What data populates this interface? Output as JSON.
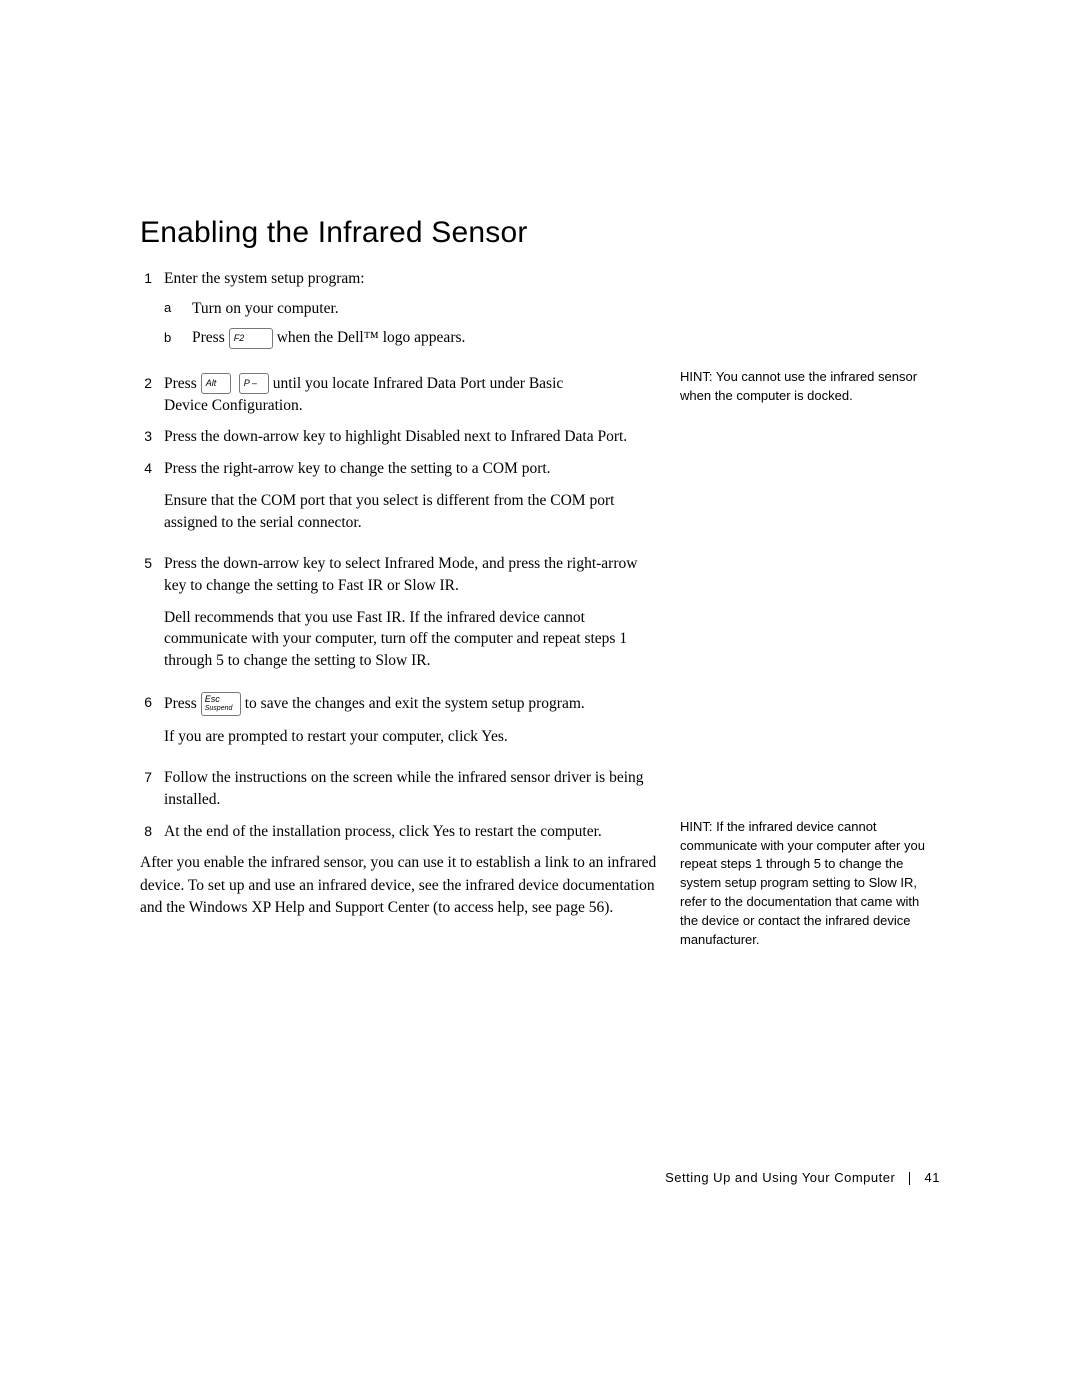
{
  "heading": "Enabling the Infrared Sensor",
  "steps": {
    "s1": {
      "num": "1",
      "text": "Enter the system setup program:",
      "sub": {
        "a": {
          "letter": "a",
          "text": "Turn on your computer."
        },
        "b": {
          "letter": "b",
          "before": "Press",
          "key_label": "F2",
          "after": " when the Dell™ logo appears."
        }
      }
    },
    "s2": {
      "num": "2",
      "before": "Press",
      "key1": "Alt",
      "key2": "P –",
      "after_keys": " until you locate Infrared Data Port under Basic",
      "line2": "Device Configuration."
    },
    "s3": {
      "num": "3",
      "text": "Press the down-arrow key to highlight Disabled next to Infrared Data Port."
    },
    "s4": {
      "num": "4",
      "text": "Press the right-arrow key to change the setting to a COM port.",
      "para": "Ensure that the COM port that you select is different from the COM port assigned to the serial connector."
    },
    "s5": {
      "num": "5",
      "text": "Press the down-arrow key to select Infrared Mode, and press the right-arrow key to change the setting to Fast IR or Slow IR.",
      "para": "Dell recommends that you use Fast IR. If the infrared device cannot communicate with your computer, turn off the computer and repeat steps 1 through 5 to change the setting to Slow IR."
    },
    "s6": {
      "num": "6",
      "before": "Press",
      "key_l1": "Esc",
      "key_l2": "Suspend",
      "after": " to save the changes and exit the system setup program.",
      "para": "If you are prompted to restart your computer, click Yes."
    },
    "s7": {
      "num": "7",
      "text": "Follow the instructions on the screen while the infrared sensor driver is being installed."
    },
    "s8": {
      "num": "8",
      "text": "At the end of the installation process, click Yes to restart the computer."
    }
  },
  "after": "After you enable the infrared sensor, you can use it to establish a link to an infrared device. To set up and use an infrared device, see the infrared device documentation and the Windows XP Help and Support Center (to access help, see page 56).",
  "hints": {
    "h1": {
      "label": "HINT:",
      "text": " You cannot use the infrared sensor when the computer is docked."
    },
    "h2": {
      "label": "HINT:",
      "text": " If the infrared device cannot communicate with your computer after you repeat steps 1 through 5 to change the system setup program setting to Slow IR, refer to the documentation that came with the device or contact the infrared device manufacturer."
    }
  },
  "footer": {
    "section": "Setting Up and Using Your Computer",
    "page": "41"
  }
}
